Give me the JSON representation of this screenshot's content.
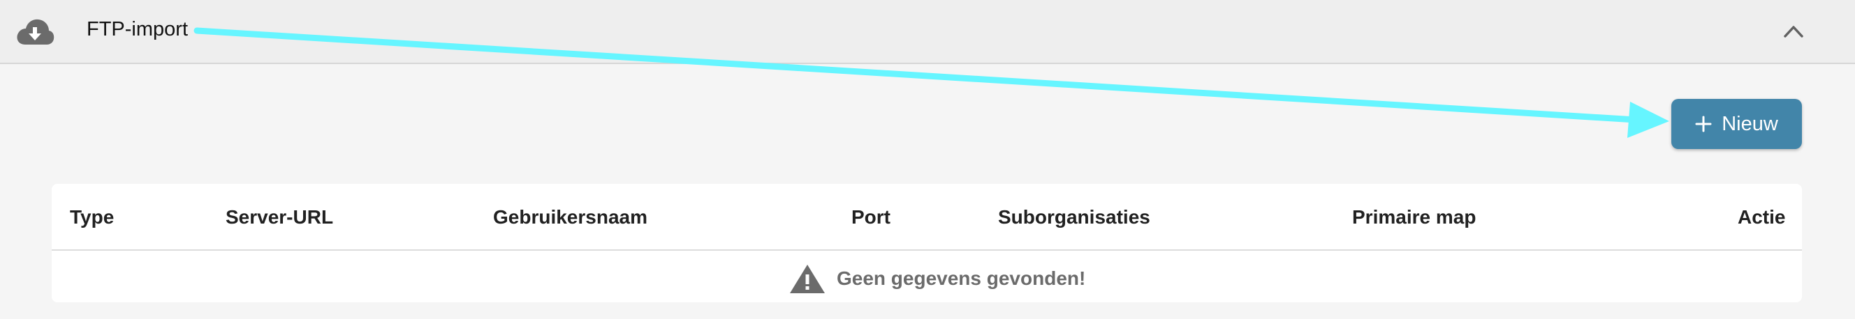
{
  "header": {
    "title": "FTP-import",
    "icon": "cloud-download-icon",
    "collapse_icon": "chevron-up-icon"
  },
  "toolbar": {
    "new_label": "Nieuw",
    "new_icon": "plus-icon"
  },
  "table": {
    "columns": [
      "Type",
      "Server-URL",
      "Gebruikersnaam",
      "Port",
      "Suborganisaties",
      "Primaire map",
      "Actie"
    ],
    "empty_message": "Geen gegevens gevonden!",
    "empty_icon": "warning-icon"
  },
  "colors": {
    "accent": "#4285a9",
    "annotation_arrow": "#66f5ff"
  }
}
